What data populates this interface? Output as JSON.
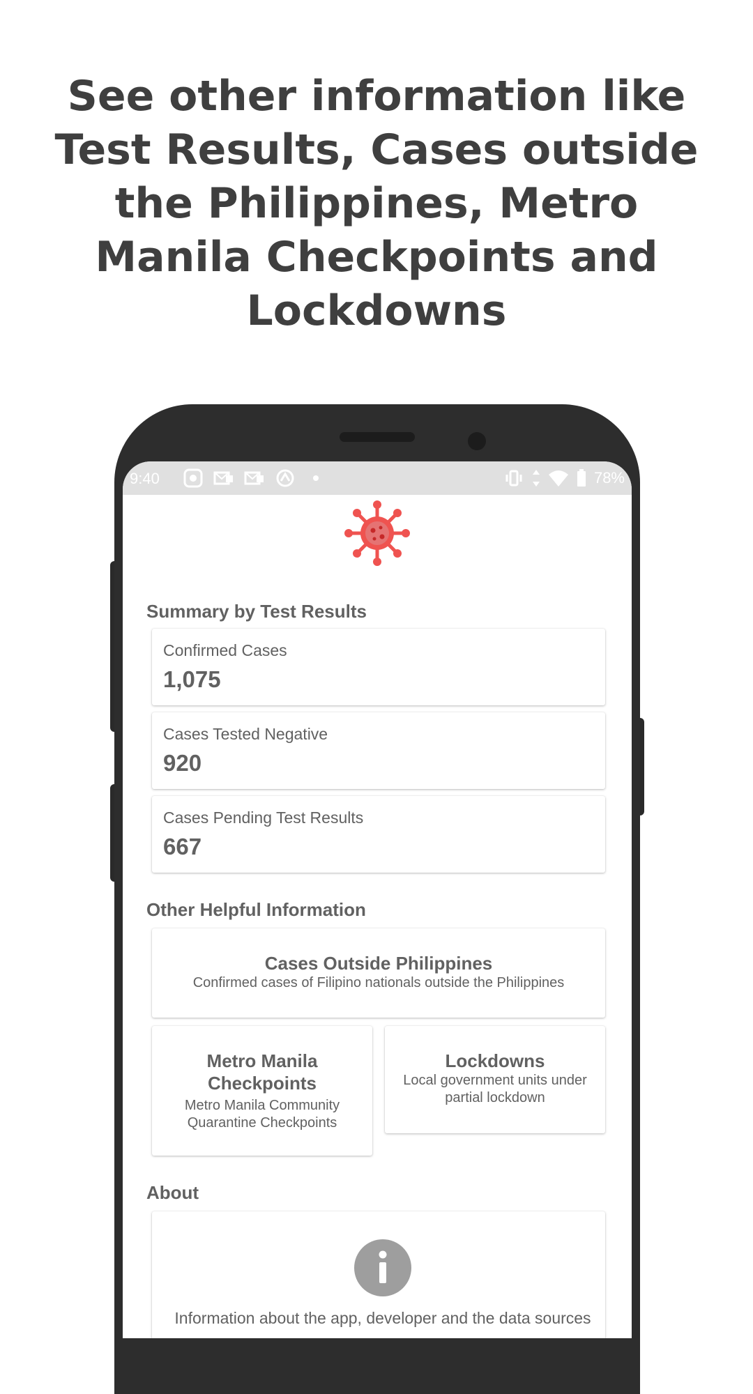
{
  "headline": "See other information like Test Results, Cases outside the Philippines, Metro Manila Checkpoints and Lockdowns",
  "status_bar": {
    "time": "9:40",
    "battery": "78%",
    "icons": [
      "notification-icon",
      "mail-icon",
      "mail-icon",
      "sync-icon",
      "dot-icon",
      "vibrate-icon",
      "data-arrows-icon",
      "wifi-icon",
      "battery-icon"
    ]
  },
  "app": {
    "logo_icon": "virus-icon",
    "logo_color": "#ef5350",
    "summary": {
      "title": "Summary by Test Results",
      "cards": [
        {
          "label": "Confirmed Cases",
          "value": "1,075"
        },
        {
          "label": "Cases Tested Negative",
          "value": "920"
        },
        {
          "label": "Cases Pending Test Results",
          "value": "667"
        }
      ]
    },
    "other": {
      "title": "Other Helpful Information",
      "outside": {
        "title": "Cases Outside Philippines",
        "desc": "Confirmed cases of Filipino nationals outside the Philippines"
      },
      "checkpoints": {
        "title": "Metro Manila Checkpoints",
        "desc": "Metro Manila Community Quarantine Checkpoints"
      },
      "lockdowns": {
        "title": "Lockdowns",
        "desc": "Local government units under partial lockdown"
      }
    },
    "about": {
      "title": "About",
      "icon": "info-icon",
      "desc": "Information about the app, developer and the data sources"
    }
  }
}
